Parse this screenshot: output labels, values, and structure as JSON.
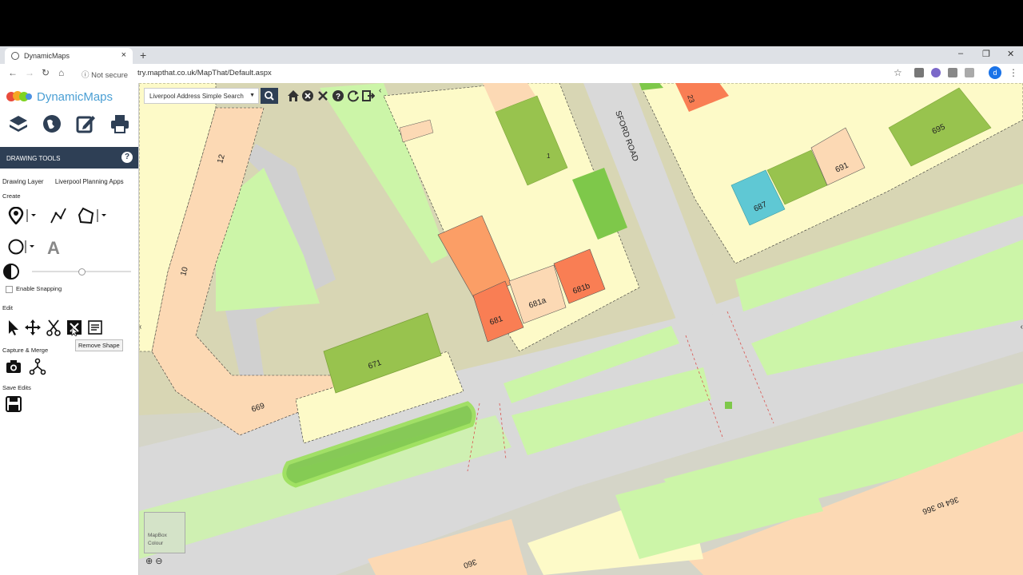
{
  "browser": {
    "tab_title": "DynamicMaps",
    "new_tab": "+",
    "security": "Not secure",
    "url": "try.mapthat.co.uk/MapThat/Default.aspx",
    "profile_initial": "d"
  },
  "app": {
    "logo_text": "DynamicMaps",
    "panel_title": "DRAWING TOOLS",
    "help": "?",
    "layer_tabs": [
      "Drawing Layer",
      "Liverpool Planning Apps"
    ],
    "sections": {
      "create": "Create",
      "edit": "Edit",
      "capture": "Capture & Merge",
      "save": "Save Edits"
    },
    "snapping_label": "Enable Snapping",
    "tooltip": "Remove Shape"
  },
  "map": {
    "search_value": "Liverpool Address Simple Search",
    "road_name": "SFORD ROAD",
    "basemap_label_1": "MapBox",
    "basemap_label_2": "Colour",
    "labels": {
      "l23": "23",
      "l1": "1",
      "l695": "695",
      "l691": "691",
      "l687": "687",
      "l12": "12",
      "l10": "10",
      "l681b": "681b",
      "l681a": "681a",
      "l681": "681",
      "l671": "671",
      "l669": "669",
      "l364": "364 to 366",
      "l360": "360"
    }
  }
}
